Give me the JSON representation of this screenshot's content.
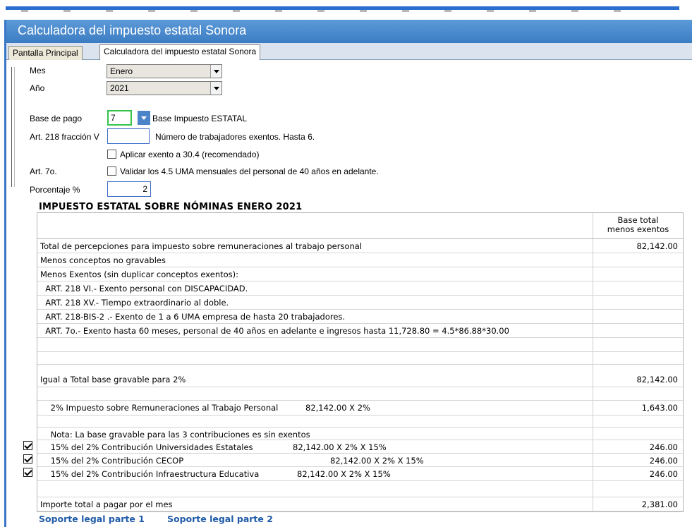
{
  "window": {
    "title": "Calculadora del impuesto estatal Sonora",
    "tabs": [
      "Pantalla Principal",
      "Calculadora del impuesto estatal Sonora"
    ]
  },
  "form": {
    "mes_label": "Mes",
    "mes_value": "Enero",
    "anio_label": "Año",
    "anio_value": "2021",
    "base_label": "Base de pago",
    "base_value": "7",
    "base_desc": "Base Impuesto ESTATAL",
    "art218_label": "Art. 218 fracción V",
    "art218_value": "",
    "art218_desc": "Número de trabajadores exentos. Hasta 6.",
    "aplicar_label": "Aplicar exento a 30.4 (recomendado)",
    "aplicar_checked": false,
    "art7_label": "Art. 7o.",
    "validar_label": "Validar los 4.5 UMA mensuales del personal de 40 años en adelante.",
    "validar_checked": false,
    "porcentaje_label": "Porcentaje %",
    "porcentaje_value": "2"
  },
  "report": {
    "title": "IMPUESTO ESTATAL SOBRE NÓMINAS ENERO 2021",
    "col_header_1": "Base total",
    "col_header_2": "menos exentos",
    "rows": [
      {
        "desc": "Total de percepciones para impuesto sobre remuneraciones al trabajo personal",
        "calc": "",
        "value": "82,142.00"
      },
      {
        "desc": "Menos conceptos no gravables",
        "calc": "",
        "value": ""
      },
      {
        "desc": "Menos Exentos (sin duplicar conceptos exentos):",
        "calc": "",
        "value": ""
      },
      {
        "desc": "  ART. 218 VI.- Exento personal con DISCAPACIDAD.",
        "calc": "",
        "value": ""
      },
      {
        "desc": "  ART. 218 XV.- Tiempo extraordinario al doble.",
        "calc": "",
        "value": ""
      },
      {
        "desc": "  ART. 218-BIS-2 .- Exento de 1 a 6 UMA empresa de hasta 20 trabajadores.",
        "calc": "",
        "value": ""
      },
      {
        "desc": "  ART. 7o.- Exento hasta 60 meses, personal de 40 años en adelante e ingresos hasta 11,728.80 = 4.5*86.88*30.00",
        "calc": "",
        "value": ""
      },
      {
        "desc": "",
        "calc": "",
        "value": ""
      },
      {
        "desc": "",
        "calc": "",
        "value": ""
      },
      {
        "desc": "Igual a Total base gravable para 2%",
        "calc": "",
        "value": "82,142.00"
      },
      {
        "desc": "",
        "calc": "",
        "value": ""
      },
      {
        "desc": "    2% Impuesto sobre Remuneraciones al Trabajo Personal",
        "calc": "82,142.00 X 2%",
        "value": "1,643.00"
      },
      {
        "desc": "",
        "calc": "",
        "value": ""
      },
      {
        "desc": "    Nota: La base gravable para las 3 contribuciones es sin exentos",
        "calc": "",
        "value": ""
      },
      {
        "desc": "    15% del 2% Contribución Universidades Estatales",
        "calc": "82,142.00 X 2% X 15%",
        "value": "246.00",
        "checked": true
      },
      {
        "desc": "    15% del 2% Contribución CECOP",
        "calc": "82,142.00 X 2% X 15%",
        "value": "246.00",
        "checked": true
      },
      {
        "desc": "    15% del 2% Contribución Infraestructura Educativa",
        "calc": "82,142.00 X 2% X 15%",
        "value": "246.00",
        "checked": true
      },
      {
        "desc": "",
        "calc": "",
        "value": ""
      },
      {
        "desc": "Importe total a pagar por el mes",
        "calc": "",
        "value": "2,381.00"
      }
    ]
  },
  "links": [
    "Soporte legal parte 1",
    "Soporte legal parte 2"
  ],
  "colors": {
    "title_bar": "#4a8bd0",
    "link": "#1f5ba8",
    "focus_green": "#34c34a"
  }
}
